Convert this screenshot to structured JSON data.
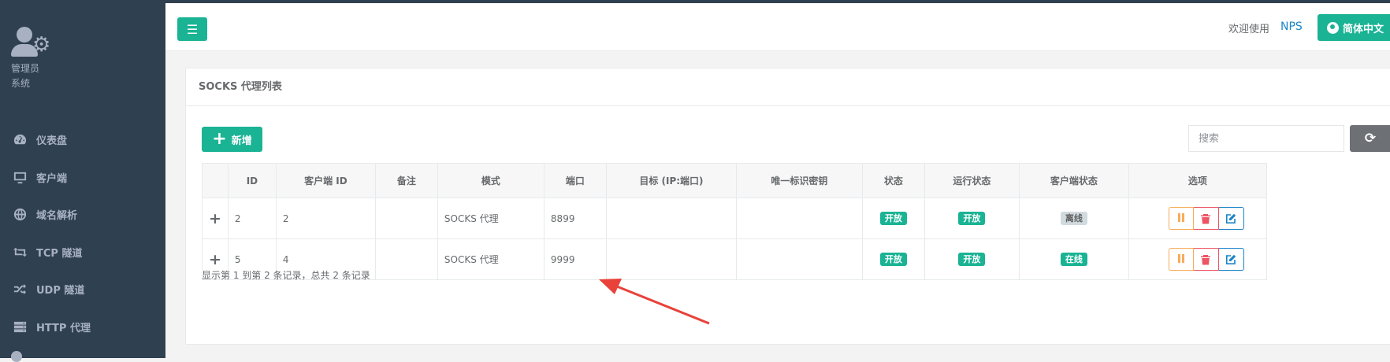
{
  "sidebar": {
    "profile_line1": "管理员",
    "profile_line2": "系统",
    "items": [
      {
        "label": "仪表盘",
        "icon": "dashboard-icon"
      },
      {
        "label": "客户端",
        "icon": "desktop-icon"
      },
      {
        "label": "域名解析",
        "icon": "globe-icon"
      },
      {
        "label": "TCP 隧道",
        "icon": "retweet-icon"
      },
      {
        "label": "UDP 隧道",
        "icon": "random-icon"
      },
      {
        "label": "HTTP 代理",
        "icon": "server-icon"
      }
    ]
  },
  "topbar": {
    "welcome": "欢迎使用",
    "brand": "NPS",
    "language": "简体中文"
  },
  "panel": {
    "title": "SOCKS 代理列表",
    "add_label": "新增",
    "search_placeholder": "搜索"
  },
  "table": {
    "headers": [
      "ID",
      "客户端 ID",
      "备注",
      "模式",
      "端口",
      "目标 (IP:端口)",
      "唯一标识密钥",
      "状态",
      "运行状态",
      "客户端状态",
      "选项"
    ],
    "rows": [
      {
        "id": "2",
        "client_id": "2",
        "remark": "",
        "mode": "SOCKS 代理",
        "port": "8899",
        "target": "",
        "key": "",
        "status": "开放",
        "run_status": "开放",
        "client_status": "离线"
      },
      {
        "id": "5",
        "client_id": "4",
        "remark": "",
        "mode": "SOCKS 代理",
        "port": "9999",
        "target": "",
        "key": "",
        "status": "开放",
        "run_status": "开放",
        "client_status": "在线"
      }
    ]
  },
  "footer": {
    "info": "显示第 1 到第 2 条记录，总共 2 条记录"
  },
  "colors": {
    "sidebar_bg": "#2f4050",
    "primary": "#1ab394",
    "link": "#1c84c6",
    "warning": "#f8ac59",
    "danger": "#ed5565",
    "annotation_arrow": "#e8423a"
  }
}
